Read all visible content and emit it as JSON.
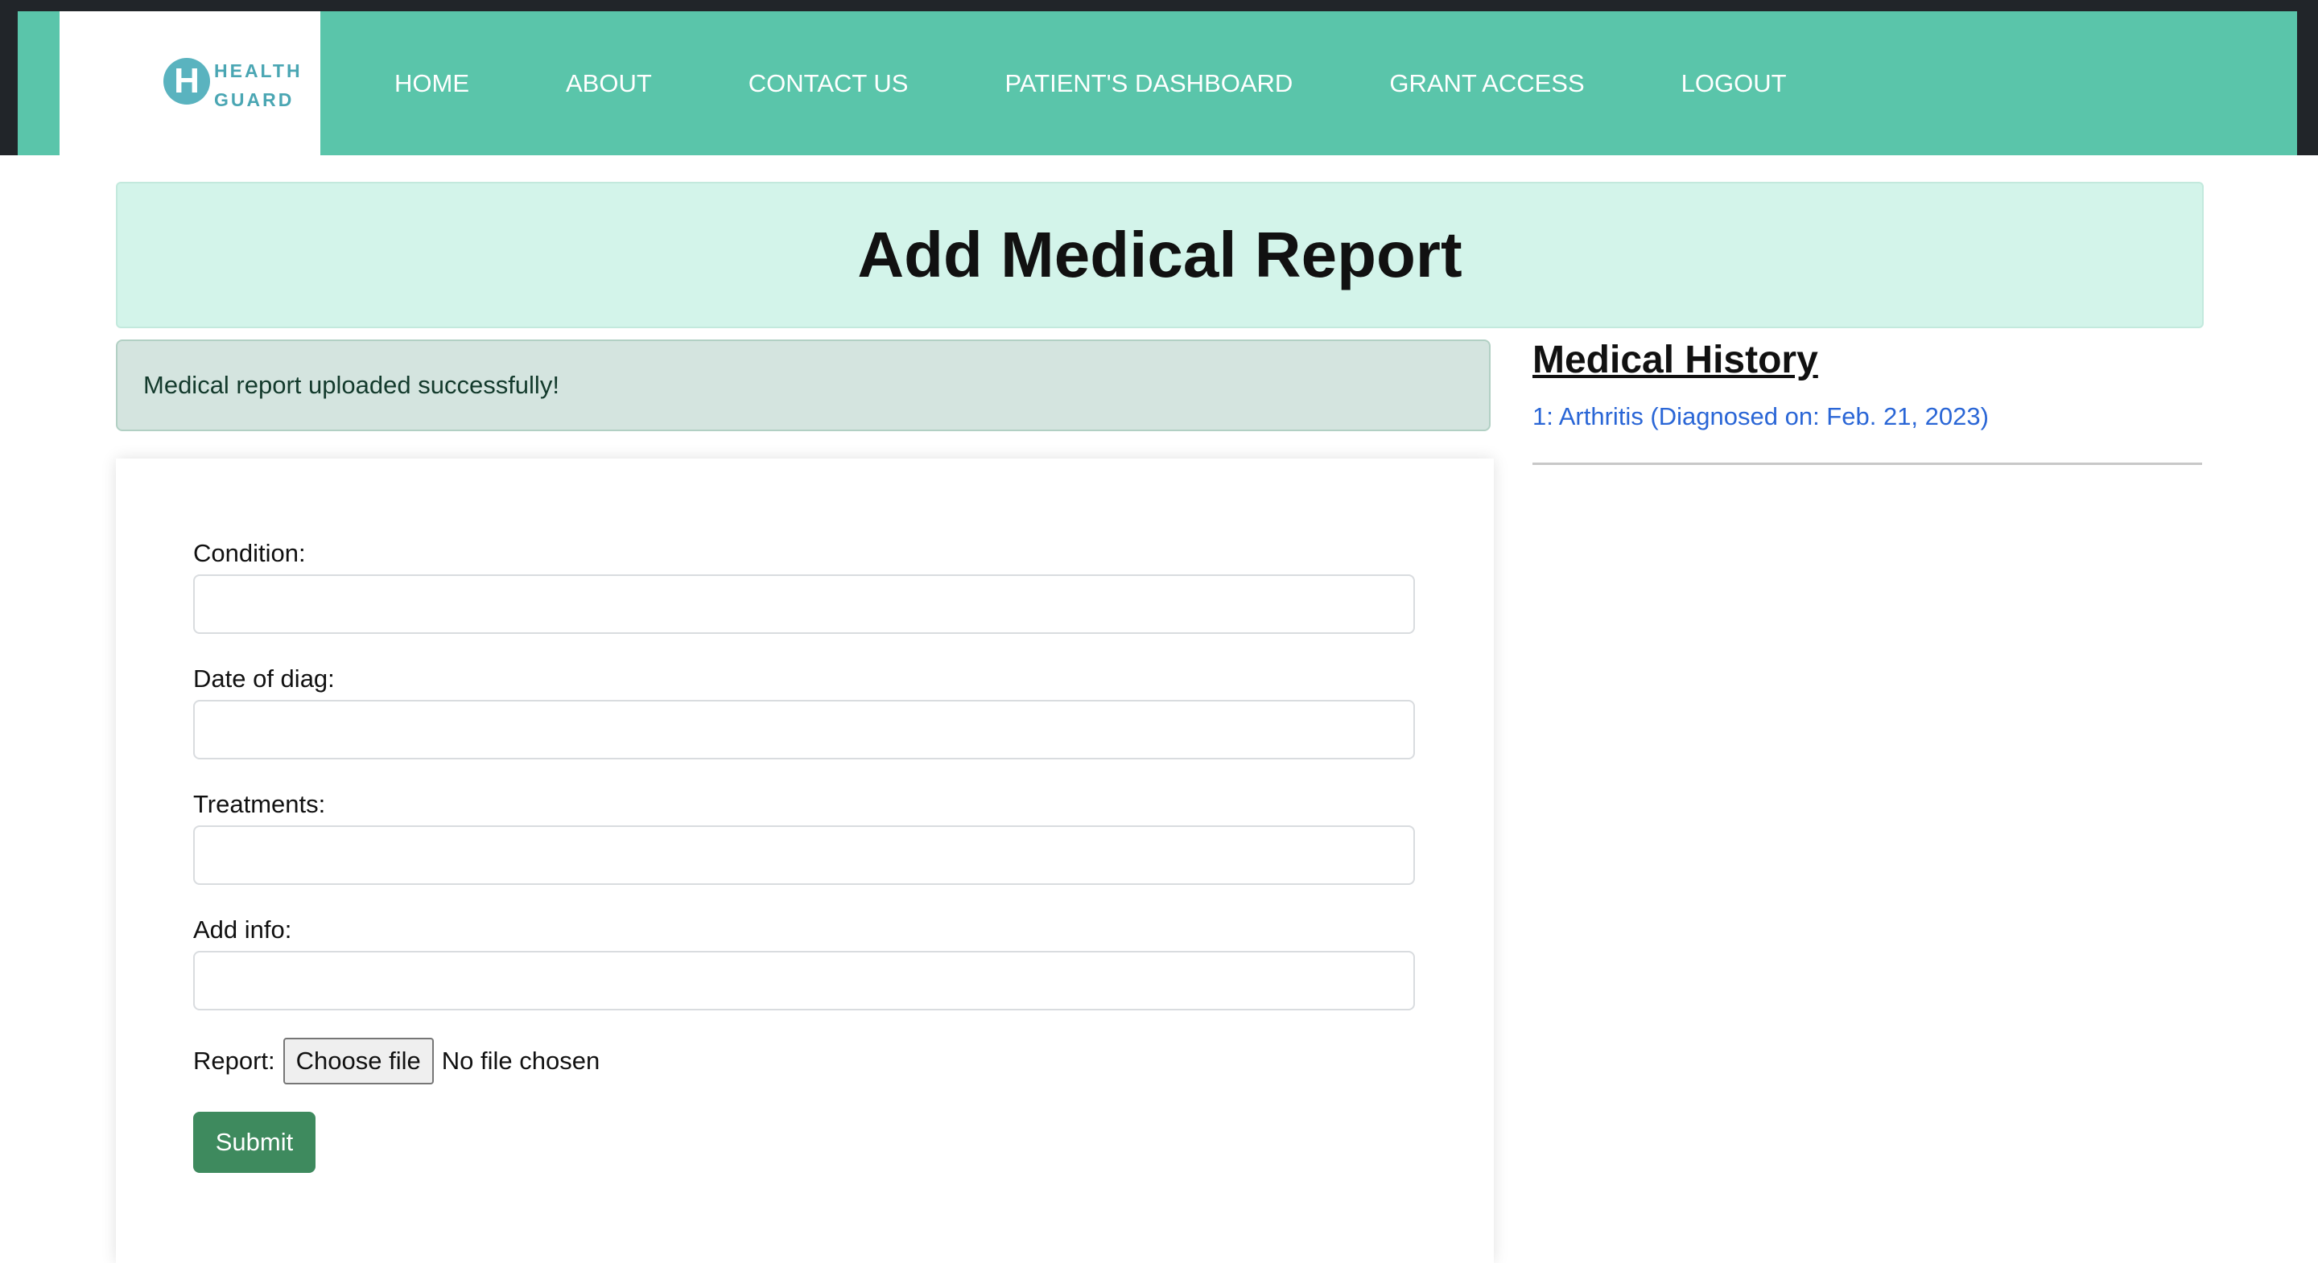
{
  "brand": {
    "line1": "HEALTH",
    "line2": "GUARD",
    "mark": "H"
  },
  "nav": {
    "items": [
      "HOME",
      "ABOUT",
      "CONTACT US",
      "PATIENT'S DASHBOARD",
      "GRANT ACCESS",
      "LOGOUT"
    ]
  },
  "page": {
    "title": "Add Medical Report"
  },
  "alert": {
    "message": "Medical report uploaded successfully!"
  },
  "form": {
    "condition_label": "Condition:",
    "condition_value": "",
    "date_label": "Date of diag:",
    "date_value": "",
    "treatments_label": "Treatments:",
    "treatments_value": "",
    "add_info_label": "Add info:",
    "add_info_value": "",
    "report_label": "Report:",
    "choose_file_label": "Choose file",
    "no_file_text": "No file chosen",
    "submit_label": "Submit"
  },
  "history": {
    "title": "Medical History",
    "items": [
      "1: Arthritis (Diagnosed on: Feb. 21, 2023)"
    ]
  },
  "colors": {
    "navbar": "#5ac5aa",
    "header_panel": "#d3f4ea",
    "alert_bg": "#d4e4df",
    "submit": "#3e8a5e",
    "link": "#2a66d6"
  }
}
